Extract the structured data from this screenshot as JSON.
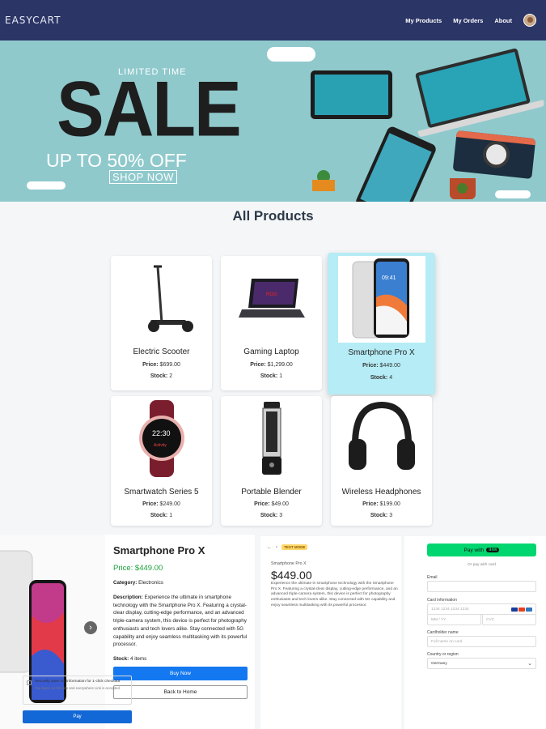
{
  "header": {
    "brand": "EASYCART",
    "nav": [
      "My Products",
      "My Orders",
      "About"
    ]
  },
  "banner": {
    "limited": "LIMITED TIME",
    "sale": "SALE",
    "upto": "UP TO 50% OFF",
    "shop_now": "SHOP NOW"
  },
  "section_title": "All Products",
  "products": [
    {
      "name": "Electric Scooter",
      "price_label": "Price:",
      "price": "$699.00",
      "stock_label": "Stock:",
      "stock": "2"
    },
    {
      "name": "Gaming Laptop",
      "price_label": "Price:",
      "price": "$1,299.00",
      "stock_label": "Stock:",
      "stock": "1"
    },
    {
      "name": "Smartphone Pro X",
      "price_label": "Price:",
      "price": "$449.00",
      "stock_label": "Stock:",
      "stock": "4"
    },
    {
      "name": "Smartwatch Series 5",
      "price_label": "Price:",
      "price": "$249.00",
      "stock_label": "Stock:",
      "stock": "1"
    },
    {
      "name": "Portable Blender",
      "price_label": "Price:",
      "price": "$49.00",
      "stock_label": "Stock:",
      "stock": "3"
    },
    {
      "name": "Wireless Headphones",
      "price_label": "Price:",
      "price": "$199.00",
      "stock_label": "Stock:",
      "stock": "3"
    }
  ],
  "detail": {
    "title": "Smartphone Pro X",
    "price": "Price: $449.00",
    "category_label": "Category:",
    "category": "Electronics",
    "description_label": "Description:",
    "description": "Experience the ultimate in smartphone technology with the Smartphone Pro X. Featuring a crystal-clear display, cutting-edge performance, and an advanced triple-camera system, this device is perfect for photography enthusiasts and tech lovers alike. Stay connected with 5G capability and enjoy seamless multitasking with its powerful processor.",
    "stock_label": "Stock:",
    "stock": "4 items",
    "buy_now": "Buy Now",
    "back_home": "Back to Home"
  },
  "checkout": {
    "test_mode": "TEST MODE",
    "product": "Smartphone Pro X",
    "price": "$449.00",
    "description": "Experience the ultimate in smartphone technology with the Smartphone Pro X. Featuring a crystal-clear display, cutting-edge performance, and an advanced triple-camera system, this device is perfect for photography enthusiasts and tech lovers alike. Stay connected with 5G capability and enjoy seamless multitasking with its powerful processor.",
    "pay_with": "Pay with",
    "link": "link",
    "or_pay": "Or pay with card",
    "email_label": "Email",
    "card_label": "Card information",
    "card_placeholder": "1234 1234 1234 1234",
    "expiry_placeholder": "MM / YY",
    "cvc_placeholder": "CVC",
    "holder_label": "Cardholder name",
    "holder_placeholder": "Full name on card",
    "country_label": "Country or region",
    "country": "Germany",
    "save_title": "Securely save my information for 1-click checkout",
    "save_sub": "Pay faster on this site and everywhere Link is accepted.",
    "pay": "Pay"
  },
  "colors": {
    "header_bg": "#2b3566",
    "banner_bg": "#8fc9cc",
    "highlight_card": "#b5ecf5",
    "price_green": "#1aa33a",
    "primary_blue": "#1478f0",
    "link_green": "#00d66f"
  }
}
